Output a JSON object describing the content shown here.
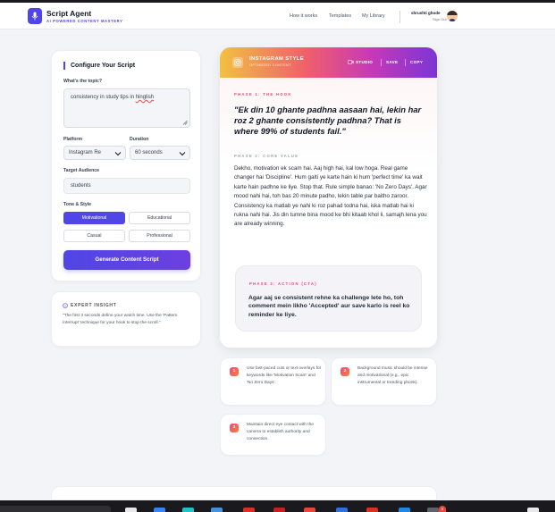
{
  "header": {
    "brand_title": "Script Agent",
    "brand_subtitle": "AI POWERED CONTENT MASTERY",
    "nav": [
      "How it works",
      "Templates",
      "My Library"
    ],
    "user_name": "shrushti ghode",
    "user_action": "Sign Out"
  },
  "config": {
    "title": "Configure Your Script",
    "topic_label": "What's the topic?",
    "topic_value_plain": "consistency in study tips in ",
    "topic_value_flagged": "hinglish",
    "platform_label": "Platform",
    "platform_value": "Instagram Re",
    "duration_label": "Duration",
    "duration_value": "60 seconds",
    "audience_label": "Target Audience",
    "audience_value": "students",
    "tone_label": "Tone & Style",
    "tones": [
      "Motivational",
      "Educational",
      "Casual",
      "Professional"
    ],
    "tone_selected": "Motivational",
    "generate_label": "Generate Content Script"
  },
  "insight": {
    "title": "EXPERT INSIGHT",
    "text": "\"The first 3 seconds define your watch time. Use the 'Pattern Interrupt' technique for your hook to stop the scroll.\""
  },
  "preview": {
    "style_title": "INSTAGRAM STYLE",
    "style_subtitle": "OPTIMIZED CONTENT",
    "actions": [
      "STUDIO",
      "SAVE",
      "COPY"
    ],
    "phase1_label": "PHASE 1: THE HOOK",
    "hook": "\"Ek din 10 ghante padhna aasaan hai, lekin har roz 2 ghante consistently padhna? That is where 99% of students fail.\"",
    "phase2_label": "PHASE 2: CORE VALUE",
    "core": "Dekho, motivation ek scam hai. Aaj high hai, kal low hoga. Real game changer hai 'Discipline'. Hum galti ye karte hain ki hum 'perfect time' ka wait karte hain padhne ke liye. Stop that. Rule simple banao: 'No Zero Days'. Agar mood nahi hai, toh bas 20 minute padho, lekin table par baitho zaroor. Consistency ka matlab ye nahi ki roz pahad todna hai, iska matlab hai ki rukna nahi hai. Jis din tumne bina mood ke bhi kitaab khol li, samajh lena you are already winning.",
    "phase3_label": "PHASE 3: ACTION (CTA)",
    "cta": "Agar aaj se consistent rehne ka challenge lete ho, toh comment mein likho 'Accepted' aur save karlo is reel ko reminder ke liye."
  },
  "tips": [
    {
      "num": "1",
      "text": "Use fast-paced cuts or text overlays for keywords like 'Motivation Scam' and 'No Zero Days'."
    },
    {
      "num": "2",
      "text": "Background music should be intense and motivational (e.g., epic instrumental or trending phonk)."
    },
    {
      "num": "3",
      "text": "Maintain direct eye contact with the camera to establish authority and connection."
    }
  ],
  "taskbar": {
    "badge": "5"
  },
  "colors": {
    "accent": "#4f46e5",
    "gradient": [
      "#f2c142",
      "#ef5f6b",
      "#c738b8",
      "#7b35d6"
    ],
    "phase_label": "#e0476f",
    "phase2_label": "#9aa1ae"
  }
}
